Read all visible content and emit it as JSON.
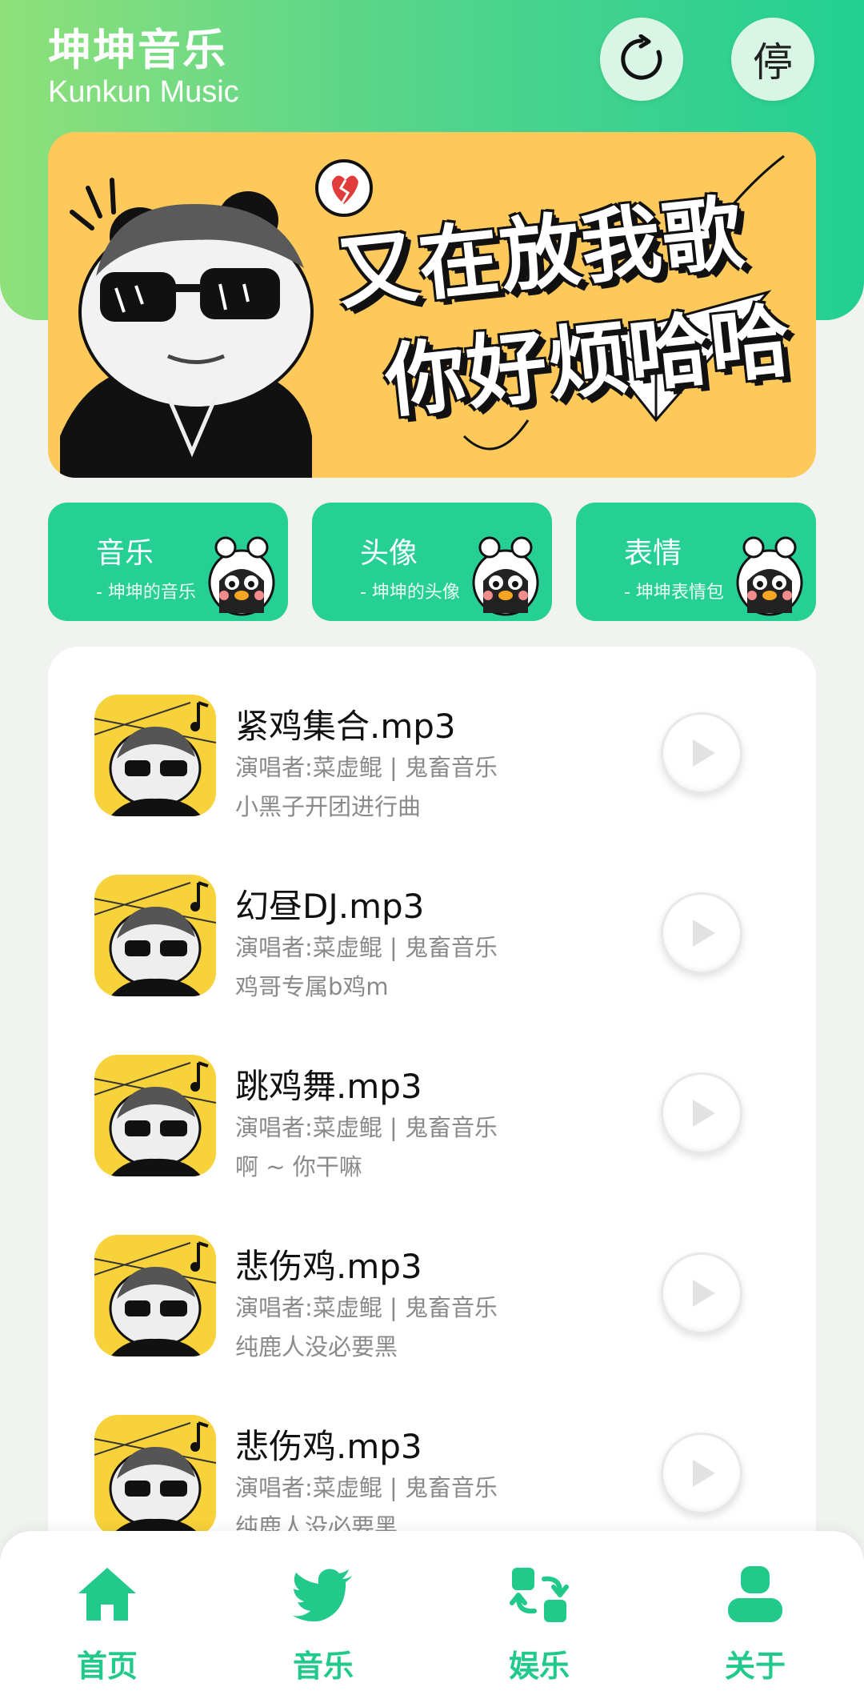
{
  "header": {
    "title": "坤坤音乐",
    "subtitle": "Kunkun Music",
    "refresh_icon": "refresh-icon",
    "stop_label": "停"
  },
  "banner": {
    "line1": "又在放我歌",
    "line2": "你好烦哈哈"
  },
  "categories": [
    {
      "title": "音乐",
      "subtitle": "- 坤坤的音乐"
    },
    {
      "title": "头像",
      "subtitle": "- 坤坤的头像"
    },
    {
      "title": "表情",
      "subtitle": "- 坤坤表情包"
    }
  ],
  "songs": [
    {
      "name": "紧鸡集合.mp3",
      "artist": "演唱者:菜虚鲲 | 鬼畜音乐",
      "desc": "小黑子开团进行曲"
    },
    {
      "name": "幻昼DJ.mp3",
      "artist": "演唱者:菜虚鲲 | 鬼畜音乐",
      "desc": "鸡哥专属b鸡m"
    },
    {
      "name": "跳鸡舞.mp3",
      "artist": "演唱者:菜虚鲲 | 鬼畜音乐",
      "desc": "啊 ~ 你干嘛"
    },
    {
      "name": "悲伤鸡.mp3",
      "artist": "演唱者:菜虚鲲 | 鬼畜音乐",
      "desc": "纯鹿人没必要黑"
    },
    {
      "name": "悲伤鸡.mp3",
      "artist": "演唱者:菜虚鲲 | 鬼畜音乐",
      "desc": "纯鹿人没必要黑"
    }
  ],
  "tabbar": [
    {
      "label": "首页",
      "icon": "home-icon"
    },
    {
      "label": "音乐",
      "icon": "bird-icon"
    },
    {
      "label": "娱乐",
      "icon": "apps-swap-icon"
    },
    {
      "label": "关于",
      "icon": "user-icon"
    }
  ],
  "colors": {
    "accent": "#26cf93",
    "banner_bg": "#fdc95a",
    "text_secondary": "#8a8a8a"
  }
}
